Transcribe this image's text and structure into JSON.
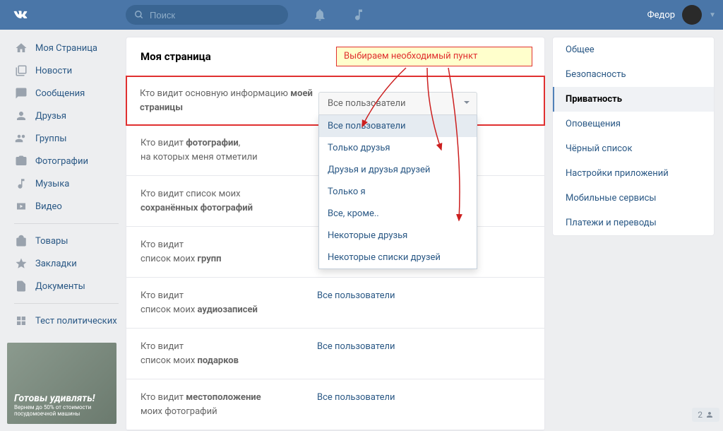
{
  "header": {
    "search_placeholder": "Поиск",
    "username": "Федор"
  },
  "left_nav": {
    "items": [
      {
        "label": "Моя Страница"
      },
      {
        "label": "Новости"
      },
      {
        "label": "Сообщения"
      },
      {
        "label": "Друзья"
      },
      {
        "label": "Группы"
      },
      {
        "label": "Фотографии"
      },
      {
        "label": "Музыка"
      },
      {
        "label": "Видео"
      },
      {
        "label": "Товары"
      },
      {
        "label": "Закладки"
      },
      {
        "label": "Документы"
      },
      {
        "label": "Тест политических"
      }
    ],
    "ad": {
      "title": "Готовы удивлять!",
      "subtitle": "Вернем до 50% от стоимости посудомоечной машины"
    }
  },
  "main": {
    "title": "Моя страница",
    "rows": [
      {
        "label_pre": "Кто видит основную информацию ",
        "label_bold": "моей страницы",
        "label_post": "",
        "value": ""
      },
      {
        "label_pre": "Кто видит ",
        "label_bold": "фотографии",
        "label_post": ",\nна которых меня отметили",
        "value": ""
      },
      {
        "label_pre": "Кто видит список моих\n",
        "label_bold": "сохранённых фотографий",
        "label_post": "",
        "value": ""
      },
      {
        "label_pre": "Кто видит\nсписок моих ",
        "label_bold": "групп",
        "label_post": "",
        "value": ""
      },
      {
        "label_pre": "Кто видит\nсписок моих ",
        "label_bold": "аудиозаписей",
        "label_post": "",
        "value": "Все пользователи"
      },
      {
        "label_pre": "Кто видит\nсписок моих ",
        "label_bold": "подарков",
        "label_post": "",
        "value": "Все пользователи"
      },
      {
        "label_pre": "Кто видит ",
        "label_bold": "местоположение",
        "label_post": "\nмоих фотографий",
        "value": "Все пользователи"
      }
    ]
  },
  "dropdown": {
    "selected": "Все пользователи",
    "options": [
      "Все пользователи",
      "Только друзья",
      "Друзья и друзья друзей",
      "Только я",
      "Все, кроме..",
      "Некоторые друзья",
      "Некоторые списки друзей"
    ]
  },
  "right_nav": {
    "items": [
      {
        "label": "Общее",
        "active": false
      },
      {
        "label": "Безопасность",
        "active": false
      },
      {
        "label": "Приватность",
        "active": true
      },
      {
        "label": "Оповещения",
        "active": false
      },
      {
        "label": "Чёрный список",
        "active": false
      },
      {
        "label": "Настройки приложений",
        "active": false
      },
      {
        "label": "Мобильные сервисы",
        "active": false
      },
      {
        "label": "Платежи и переводы",
        "active": false
      }
    ]
  },
  "annotation": "Выбираем необходимый пункт",
  "friends_count": "2"
}
